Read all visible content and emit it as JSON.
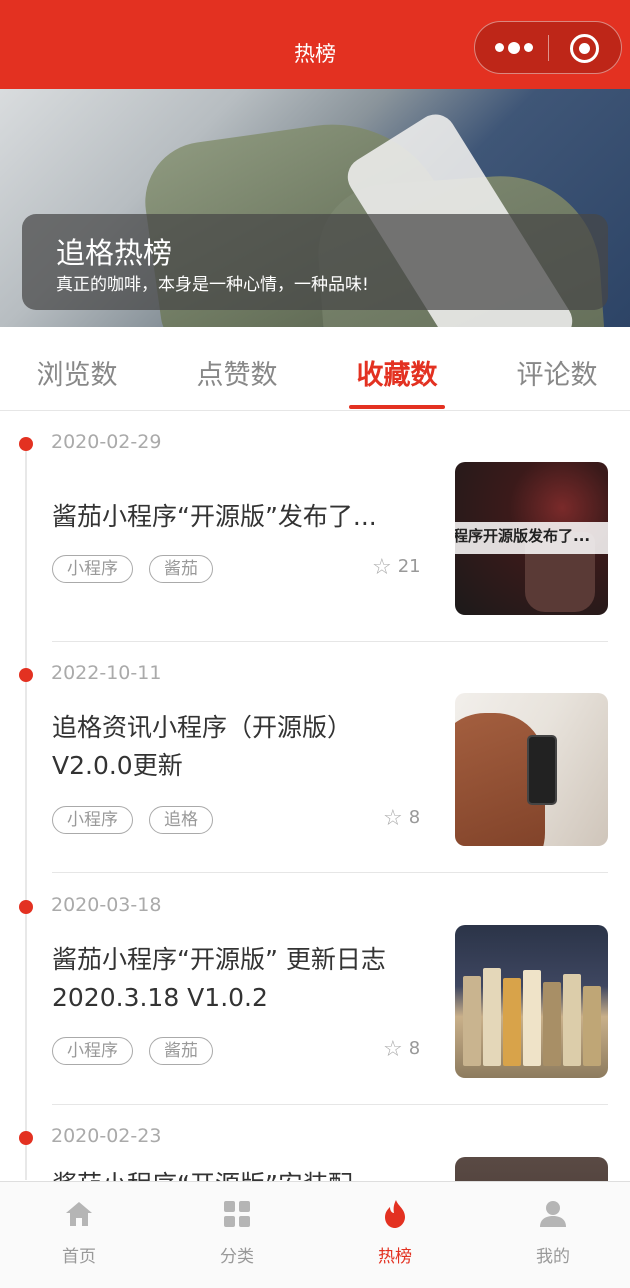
{
  "header": {
    "title": "热榜"
  },
  "banner": {
    "title": "追格热榜",
    "subtitle": "真正的咖啡，本身是一种心情，一种品味!"
  },
  "tabs": [
    {
      "label": "浏览数",
      "active": false
    },
    {
      "label": "点赞数",
      "active": false
    },
    {
      "label": "收藏数",
      "active": true
    },
    {
      "label": "评论数",
      "active": false
    }
  ],
  "posts": [
    {
      "date": "2020-02-29",
      "title": "酱茄小程序“开源版”发布了...",
      "tags": [
        "小程序",
        "酱茄"
      ],
      "favorites": "21",
      "thumb_text": "程序开源版发布了..."
    },
    {
      "date": "2022-10-11",
      "title": "追格资讯小程序（开源版）V2.0.0更新",
      "tags": [
        "小程序",
        "追格"
      ],
      "favorites": "8"
    },
    {
      "date": "2020-03-18",
      "title": "酱茄小程序“开源版” 更新日志 2020.3.18 V1.0.2",
      "tags": [
        "小程序",
        "酱茄"
      ],
      "favorites": "8"
    },
    {
      "date": "2020-02-23",
      "title": "酱茄小程序“开源版”安装配",
      "tags": [],
      "favorites": ""
    }
  ],
  "tabbar": [
    {
      "label": "首页",
      "icon": "home-icon",
      "active": false
    },
    {
      "label": "分类",
      "icon": "grid-icon",
      "active": false
    },
    {
      "label": "热榜",
      "icon": "flame-icon",
      "active": true
    },
    {
      "label": "我的",
      "icon": "user-icon",
      "active": false
    }
  ],
  "colors": {
    "accent": "#e33121",
    "muted": "#999999"
  }
}
